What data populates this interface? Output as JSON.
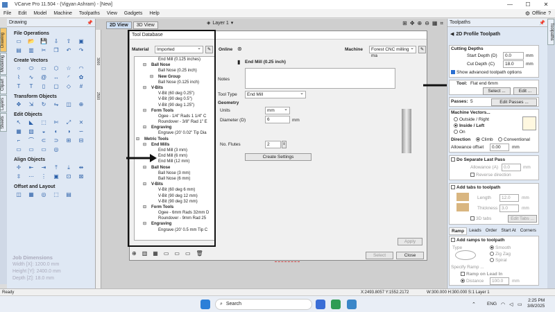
{
  "window": {
    "title": "VCarve Pro 11.504 - (Vigyan Ashram) - [New]",
    "minimize": "—",
    "maximize": "☐",
    "close": "✕"
  },
  "menu": [
    "File",
    "Edit",
    "Model",
    "Machine",
    "Toolpaths",
    "View",
    "Gadgets",
    "Help"
  ],
  "menu_right": {
    "status": "Offline"
  },
  "drawing_panel": {
    "title": "Drawing",
    "sections": {
      "file": "File Operations",
      "vectors": "Create Vectors",
      "transform": "Transform Objects",
      "edit": "Edit Objects",
      "align": "Align Objects",
      "offset": "Offset and Layout"
    },
    "job_dimensions": {
      "title": "Job Dimensions",
      "width": "Width  [X]: 1200.0 mm",
      "height": "Height [Y]: 2400.0 mm",
      "depth": "Depth  [Z]: 18.0 mm"
    }
  },
  "left_tabs": [
    "Drawing",
    "Modeling",
    "Clipart",
    "Layers",
    "Sheets"
  ],
  "view_tabs": {
    "tab2d": "2D View",
    "tab3d": "3D View",
    "layer": "Layer 1"
  },
  "ruler": {
    "y1": "3000",
    "y2": "2500"
  },
  "dialog": {
    "title": "Tool Database",
    "material_label": "Material",
    "material_value": "Imported",
    "online_label": "Online",
    "machine_label": "Machine",
    "machine_value": "Forest CNC milling ma",
    "tool_name": "End Mill (0.25 inch)",
    "notes_label": "Notes",
    "tool_type_label": "Tool Type",
    "tool_type_value": "End Mill",
    "geometry_label": "Geometry",
    "units_label": "Units",
    "units_value": "mm",
    "diameter_label": "Diameter (D)",
    "diameter_value": "6",
    "diameter_unit": "mm",
    "flutes_label": "No. Flutes",
    "flutes_value": "2",
    "create_settings": "Create Settings",
    "apply": "Apply",
    "select": "Select",
    "close": "Close",
    "tree": [
      {
        "text": "End Mill (0.125 inches)",
        "level": 3,
        "bold": false
      },
      {
        "text": "Ball Nose",
        "level": 2,
        "bold": true
      },
      {
        "text": "Ball Nose (0.25 inch)",
        "level": 3,
        "bold": false
      },
      {
        "text": "New Group",
        "level": 3,
        "bold": true
      },
      {
        "text": "Ball Nose (0.125 inch)",
        "level": 3,
        "bold": false
      },
      {
        "text": "V-Bits",
        "level": 2,
        "bold": true
      },
      {
        "text": "V-Bit (60 deg 0.25\")",
        "level": 3,
        "bold": false
      },
      {
        "text": "V-Bit (90 deg 0.5\")",
        "level": 3,
        "bold": false
      },
      {
        "text": "V-Bit (90 deg 1.25\")",
        "level": 3,
        "bold": false
      },
      {
        "text": "Form Tools",
        "level": 2,
        "bold": true
      },
      {
        "text": "Ogee - 1/4\" Rads 1 1/4\" C",
        "level": 3,
        "bold": false
      },
      {
        "text": "Roundover - 3/8\" Rad 1\" E",
        "level": 3,
        "bold": false
      },
      {
        "text": "Engraving",
        "level": 2,
        "bold": true
      },
      {
        "text": "Engrave (20' 0.02\" Tip Dia",
        "level": 3,
        "bold": false
      },
      {
        "text": "Metric Tools",
        "level": 1,
        "bold": true
      },
      {
        "text": "End Mills",
        "level": 2,
        "bold": true
      },
      {
        "text": "End Mill (3 mm)",
        "level": 3,
        "bold": false
      },
      {
        "text": "End Mill (6 mm)",
        "level": 3,
        "bold": false
      },
      {
        "text": "End Mill (12 mm)",
        "level": 3,
        "bold": false
      },
      {
        "text": "Ball Nose",
        "level": 2,
        "bold": true
      },
      {
        "text": "Ball Nose (3 mm)",
        "level": 3,
        "bold": false
      },
      {
        "text": "Ball Nose (6 mm)",
        "level": 3,
        "bold": false
      },
      {
        "text": "V-Bits",
        "level": 2,
        "bold": true
      },
      {
        "text": "V-Bit (60 deg 6 mm)",
        "level": 3,
        "bold": false
      },
      {
        "text": "V-Bit (90 deg 12 mm)",
        "level": 3,
        "bold": false
      },
      {
        "text": "V-Bit (90 deg 32 mm)",
        "level": 3,
        "bold": false
      },
      {
        "text": "Form Tools",
        "level": 2,
        "bold": true
      },
      {
        "text": "Ogee - 6mm Rads 32mm D",
        "level": 3,
        "bold": false
      },
      {
        "text": "Roundover - 9mm Rad 25",
        "level": 3,
        "bold": false
      },
      {
        "text": "Engraving",
        "level": 2,
        "bold": true
      },
      {
        "text": "Engrave (20' 0.5 mm Tip C",
        "level": 3,
        "bold": false
      }
    ]
  },
  "toolpaths": {
    "panel_title": "Toolpaths",
    "strip_label": "Toolpaths",
    "title": "2D Profile Toolpath",
    "cutting_depths": "Cutting Depths",
    "start_depth_label": "Start Depth (D)",
    "start_depth_value": "0.0",
    "cut_depth_label": "Cut Depth (C)",
    "cut_depth_value": "18.0",
    "unit": "mm",
    "show_advanced": "Show advanced toolpath options",
    "tool_label": "Tool:",
    "tool_value": "Flat end 6mm",
    "select_btn": "Select ...",
    "edit_btn": "Edit ...",
    "passes_label": "Passes:",
    "passes_value": "5",
    "edit_passes": "Edit Passes ...",
    "machine_vectors": "Machine Vectors...",
    "outside": "Outside / Right",
    "inside": "Inside / Left",
    "on": "On",
    "direction_label": "Direction",
    "climb": "Climb",
    "conventional": "Conventional",
    "allowance_label": "Allowance offset",
    "allowance_value": "0.00",
    "separate_last": "Do Separate Last Pass",
    "allowance_a": "Allowance (A)",
    "allowance_a_value": "0.0",
    "reverse_direction": "Reverse direction",
    "add_tabs": "Add tabs to toolpath",
    "length_label": "Length",
    "length_value": "12.0",
    "thickness_label": "Thickness",
    "thickness_value": "3.0",
    "tabs3d": "3D tabs",
    "edit_tabs": "Edit Tabs ...",
    "tabs": [
      "Ramp",
      "Leads",
      "Order",
      "Start At",
      "Corners"
    ],
    "add_ramps": "Add ramps to toolpath",
    "type_label": "Type",
    "smooth": "Smooth",
    "zigzag": "Zig Zag",
    "spiral": "Spiral",
    "specify_ramp": "Specify Ramp ...",
    "ramp_lead_in": "Ramp on Lead In",
    "distance_label": "Distance",
    "distance_value": "100.0"
  },
  "status": {
    "left": "Ready",
    "coords": "X:2493.8057 Y:1552.2172",
    "right": "W:300.000  H:300.000  S:1  Layer 1"
  },
  "taskbar": {
    "search": "Search",
    "lang": "ENG",
    "time": "2:25 PM",
    "date": "3/8/2025"
  }
}
